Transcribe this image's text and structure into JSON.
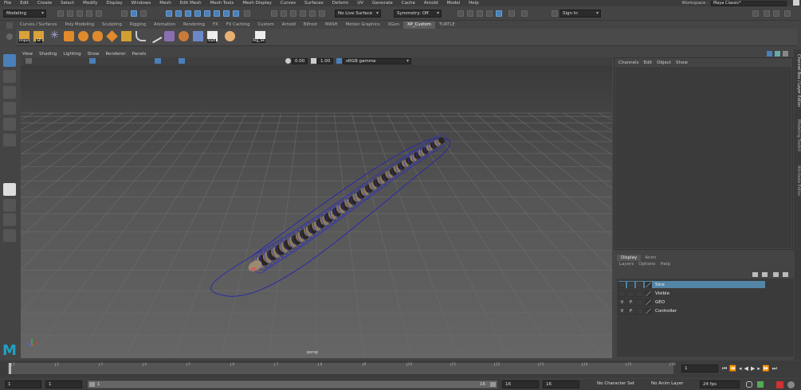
{
  "menubar": {
    "items": [
      "File",
      "Edit",
      "Create",
      "Select",
      "Modify",
      "Display",
      "Windows",
      "Mesh",
      "Edit Mesh",
      "Mesh Tools",
      "Mesh Display",
      "Curves",
      "Surfaces",
      "Deform",
      "UV",
      "Generate",
      "Cache",
      "Arnold",
      "Model",
      "Help"
    ],
    "workspace_label": "Workspace :",
    "workspace_value": "Maya Classic*"
  },
  "statusline": {
    "mode": "Modeling",
    "live_surface": "No Live Surface",
    "symmetry": "Symmetry: Off",
    "sign_in": "Sign In"
  },
  "shelf": {
    "tabs": [
      "Curves / Surfaces",
      "Poly Modeling",
      "Sculpting",
      "Rigging",
      "Animation",
      "Rendering",
      "FX",
      "FX Caching",
      "Custom",
      "Arnold",
      "Bifrost",
      "MASH",
      "Motion Graphics",
      "XGen",
      "XP_Custom",
      "TURTLE"
    ],
    "active_tab": "XP_Custom",
    "labels": {
      "impo": "Impo",
      "sp": "SP",
      "outl": "Outl",
      "rig": "Rig_Sk"
    }
  },
  "viewport": {
    "menu": [
      "View",
      "Shading",
      "Lighting",
      "Show",
      "Renderer",
      "Panels"
    ],
    "exposure": "0.00",
    "gamma": "1.00",
    "colorspace": "sRGB gamma",
    "camera": "persp"
  },
  "channelbox": {
    "menu": [
      "Channels",
      "Edit",
      "Object",
      "Show"
    ]
  },
  "sidebar_tabs": [
    "Channel Box / Layer Editor",
    "Modeling Toolkit",
    "Attribute Editor"
  ],
  "layers": {
    "tabs": [
      "Display",
      "Anim"
    ],
    "menu": [
      "Layers",
      "Options",
      "Help"
    ],
    "rows": [
      {
        "v": "",
        "p": "",
        "name": "Sine",
        "selected": true
      },
      {
        "v": "",
        "p": "",
        "name": "Visible",
        "selected": false
      },
      {
        "v": "V",
        "p": "P",
        "name": "GEO",
        "selected": false
      },
      {
        "v": "V",
        "p": "P",
        "name": "Controller",
        "selected": false
      }
    ]
  },
  "timeslider": {
    "ticks": [
      "1",
      "2",
      "3",
      "4",
      "5",
      "6",
      "7",
      "8",
      "9",
      "10",
      "11",
      "12",
      "13",
      "14",
      "15",
      "16"
    ],
    "current_frame": "1"
  },
  "range": {
    "start": "1",
    "start_inner": "1",
    "range_start_label": "1",
    "range_end_label": "16",
    "end_inner": "16",
    "end": "16",
    "character_set": "No Character Set",
    "anim_layer": "No Anim Layer",
    "fps": "24 fps"
  },
  "colors": {
    "accent": "#5285a6",
    "maya_logo": "#1fa3c4"
  }
}
